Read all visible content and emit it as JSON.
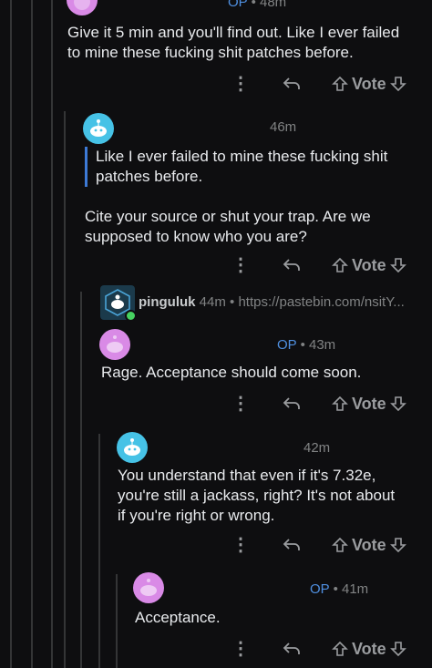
{
  "comments": [
    {
      "meta_op": "OP",
      "meta_time": "48m",
      "body": "Give it 5 min and you'll find out. Like I ever failed to mine these fucking shit patches before."
    },
    {
      "meta_time": "46m",
      "quote": "Like I ever failed to mine these fucking shit patches before.",
      "body": "Cite your source or shut your trap. Are we supposed to know who you are?"
    },
    {
      "username": "pinguluk",
      "meta_time": "44m",
      "meta_link": "https://pastebin.com/nsitY..."
    },
    {
      "meta_op": "OP",
      "meta_time": "43m",
      "body": "Rage. Acceptance should come soon."
    },
    {
      "meta_time": "42m",
      "body": "You understand that even if it's 7.32e, you're still a jackass, right? It's not about if you're right or wrong."
    },
    {
      "meta_op": "OP",
      "meta_time": "41m",
      "body": "Acceptance."
    }
  ],
  "actions": {
    "more": "⋮",
    "vote_label": "Vote"
  },
  "colors": {
    "background": "#0e0e10",
    "op_blue": "#4f8fe0",
    "quote_bar": "#3d7ad6",
    "avatar_teal": "#46c2e6",
    "avatar_pink": "#d98ae6"
  },
  "icons": [
    "more-icon",
    "reply-icon",
    "upvote-icon",
    "downvote-icon",
    "snoo-avatar-icon",
    "online-dot-icon"
  ]
}
